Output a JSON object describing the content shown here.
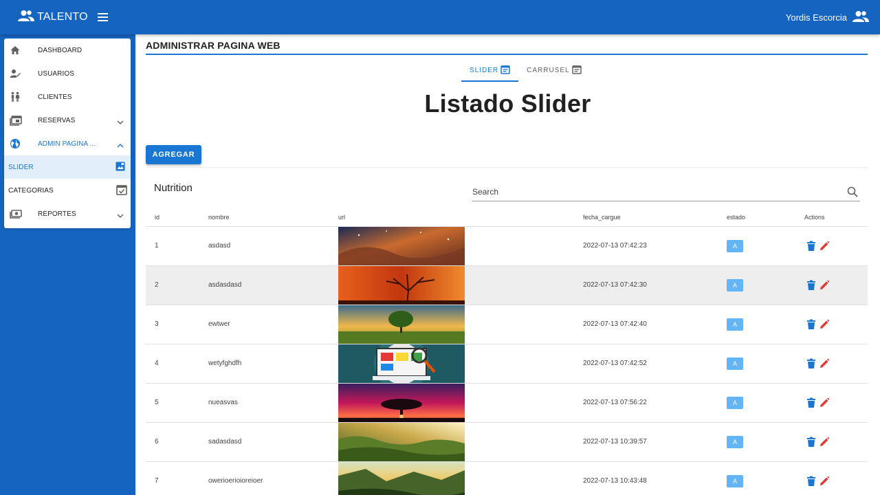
{
  "app": {
    "brand": "TALENTO",
    "user_name": "Yordis Escorcia"
  },
  "sidebar": {
    "items": [
      {
        "label": "DASHBOARD",
        "icon": "home-icon"
      },
      {
        "label": "USUARIOS",
        "icon": "user-edit-icon"
      },
      {
        "label": "CLIENTES",
        "icon": "people-icon"
      },
      {
        "label": "RESERVAS",
        "icon": "calendar-icon"
      },
      {
        "label": "ADMIN PAGINA ...",
        "icon": "globe-icon"
      },
      {
        "label": "SLIDER",
        "icon": "image-icon"
      },
      {
        "label": "CATEGORIAS",
        "icon": "calendar-check-icon"
      },
      {
        "label": "REPORTES",
        "icon": "money-icon"
      }
    ]
  },
  "page": {
    "header": "ADMINISTRAR PAGINA WEB",
    "tabs": [
      {
        "label": "SLIDER"
      },
      {
        "label": "CARRUSEL"
      }
    ],
    "title": "Listado Slider",
    "add_label": "AGREGAR"
  },
  "table": {
    "title": "Nutrition",
    "search_placeholder": "Search",
    "headers": {
      "id": "id",
      "nombre": "nombre",
      "url": "url",
      "fecha": "fecha_cargue",
      "estado": "estado",
      "actions": "Actions"
    },
    "rows": [
      {
        "id": "1",
        "nombre": "asdasd",
        "fecha": "2022-07-13 07:42:23",
        "estado": "A"
      },
      {
        "id": "2",
        "nombre": "asdasdasd",
        "fecha": "2022-07-13 07:42:30",
        "estado": "A"
      },
      {
        "id": "3",
        "nombre": "ewtwer",
        "fecha": "2022-07-13 07:42:40",
        "estado": "A"
      },
      {
        "id": "4",
        "nombre": "wetyfghdfh",
        "fecha": "2022-07-13 07:42:52",
        "estado": "A"
      },
      {
        "id": "5",
        "nombre": "nueasvas",
        "fecha": "2022-07-13 07:56:22",
        "estado": "A"
      },
      {
        "id": "6",
        "nombre": "sadasdasd",
        "fecha": "2022-07-13 10:39:57",
        "estado": "A"
      },
      {
        "id": "7",
        "nombre": "owerioerioioreioer",
        "fecha": "2022-07-13 10:43:48",
        "estado": "A"
      }
    ]
  },
  "colors": {
    "primary": "#1565c0",
    "accent": "#1976d2",
    "badge": "#64b5f6",
    "edit": "#e53935"
  }
}
